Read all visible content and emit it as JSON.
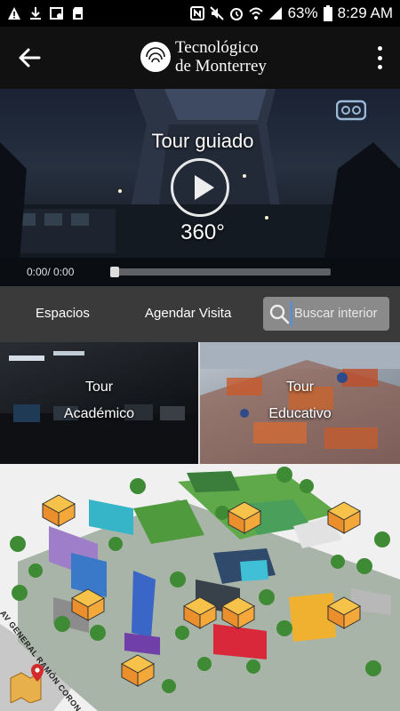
{
  "status_bar": {
    "battery": "63%",
    "time": "8:29 AM",
    "icons": [
      "triangle-alert-icon",
      "download-icon",
      "image-icon",
      "sd-card-icon",
      "nfc-icon",
      "mute-icon",
      "alarm-icon",
      "wifi-icon",
      "signal-icon",
      "battery-icon"
    ]
  },
  "header": {
    "brand_line1": "Tecnológico",
    "brand_line2": "de Monterrey",
    "back_icon": "arrow-left-icon",
    "menu_icon": "more-vertical-icon"
  },
  "hero": {
    "title": "Tour guiado",
    "caption": "360°",
    "timecode": "0:00/ 0:00",
    "progress": 0,
    "vr_icon": "vr-headset-icon",
    "play_icon": "play-icon"
  },
  "tabs": {
    "espacios": "Espacios",
    "agendar": "Agendar Visita",
    "search_placeholder": "Buscar interior",
    "search_value": ""
  },
  "tiles": [
    {
      "line1": "Tour",
      "line2": "Académico"
    },
    {
      "line1": "Tour",
      "line2": "Educativo"
    }
  ],
  "map": {
    "street_label": "AV GENERAL RAMÓN CORONA",
    "map_icon": "map-pin-icon"
  },
  "colors": {
    "appbar": "#111111",
    "tabrow": "#3a3a3a",
    "search_bg": "#8a8a8a",
    "marker": "#f7b23b"
  }
}
